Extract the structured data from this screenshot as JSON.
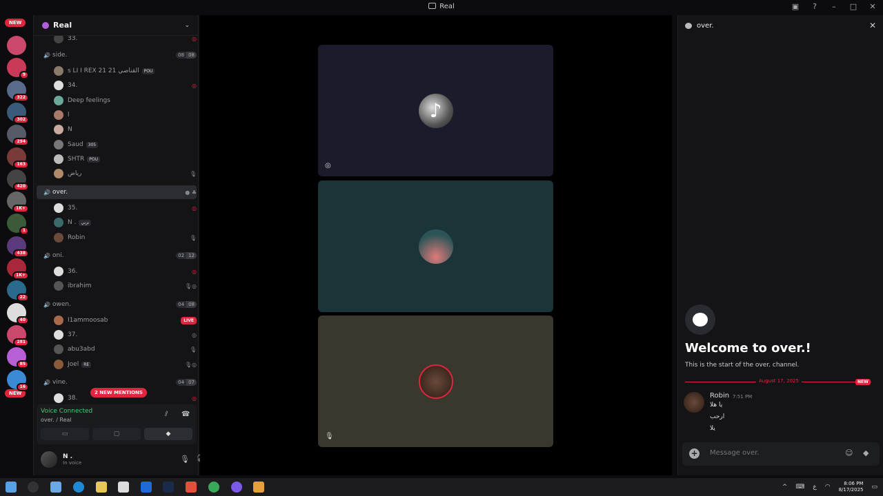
{
  "window": {
    "title": "Real"
  },
  "server": {
    "name": "Real"
  },
  "guilds": [
    {
      "badge": "",
      "color": "#c9486b"
    },
    {
      "badge": "9",
      "color": "#c93a58"
    },
    {
      "badge": "322",
      "color": "#5a6a8a"
    },
    {
      "badge": "302",
      "color": "#3a5a7a"
    },
    {
      "badge": "294",
      "color": "#555a66"
    },
    {
      "badge": "163",
      "color": "#7a3a3a"
    },
    {
      "badge": "420",
      "color": "#444"
    },
    {
      "badge": "1K+",
      "color": "#666"
    },
    {
      "badge": "1",
      "color": "#3a5a3a"
    },
    {
      "badge": "438",
      "color": "#5a3a7a"
    },
    {
      "badge": "1K+",
      "color": "#a8283a"
    },
    {
      "badge": "22",
      "color": "#2a6a8a"
    },
    {
      "badge": "40",
      "color": "#ddd"
    },
    {
      "badge": "281",
      "color": "#c9486b"
    },
    {
      "badge": "85",
      "color": "#b95fd6"
    },
    {
      "badge": "16",
      "color": "#3a8ad6"
    }
  ],
  "guild_new_label": "NEW",
  "channels": {
    "top_user": "33.",
    "side": {
      "name": "side.",
      "count_a": "08",
      "count_b": "08",
      "users": [
        "ꜱ LI I REX 21 القناصي 21",
        "34.",
        "Deep feelings",
        "ا",
        "N",
        "Saud",
        "SHTR",
        "رياض"
      ],
      "tags": [
        "POU",
        "",
        "",
        "",
        "",
        "305",
        "POU",
        ""
      ]
    },
    "over": {
      "name": "over.",
      "users": [
        "35.",
        "N .",
        "Robin"
      ],
      "tags": [
        "",
        "نزني",
        ""
      ]
    },
    "oni": {
      "name": "oni.",
      "count_a": "02",
      "count_b": "12",
      "users": [
        "36.",
        "ibrahim"
      ]
    },
    "owen": {
      "name": "owen.",
      "count_a": "04",
      "count_b": "08",
      "users": [
        "I1ammoosab",
        "37.",
        "abu3abd",
        "Joel"
      ],
      "live": "LIVE",
      "joel_tag": "RE"
    },
    "vine": {
      "name": "vine.",
      "count_a": "04",
      "count_b": "07",
      "users": [
        "38."
      ]
    }
  },
  "mentions": "2 NEW MENTIONS",
  "voice": {
    "status": "Voice Connected",
    "location": "over. / Real"
  },
  "user": {
    "name": "N .",
    "status": "In voice"
  },
  "chat": {
    "channel": "over.",
    "welcome_title": "Welcome to over.!",
    "welcome_sub": "This is the start of the over. channel.",
    "date": "August 17, 2025",
    "new_label": "NEW",
    "message": {
      "author": "Robin",
      "time": "7:51 PM",
      "lines": [
        "يا هلا",
        "ارحب",
        "يلا"
      ]
    },
    "placeholder": "Message over."
  },
  "taskbar": {
    "time": "8:06 PM",
    "date": "8/17/2025"
  }
}
